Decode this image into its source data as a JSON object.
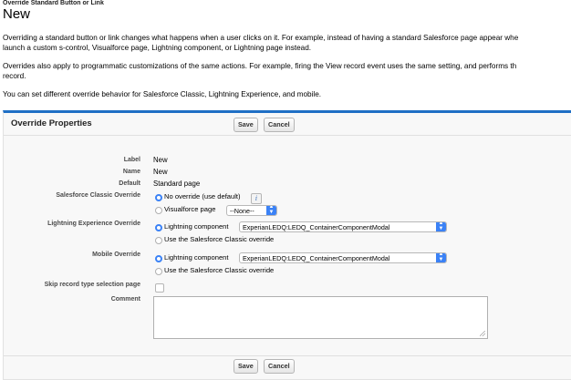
{
  "page": {
    "breadcrumb": "Override Standard Button or Link",
    "title": "New",
    "paragraph1_line1": "Overriding a standard button or link changes what happens when a user clicks on it. For example, instead of having a standard Salesforce page appear whe",
    "paragraph1_line2": "launch a custom s-control, Visualforce page, Lightning component, or Lightning page instead.",
    "paragraph2_line1": "Overrides also apply to programmatic customizations of the same actions. For example, firing the View record event uses the same setting, and performs th",
    "paragraph2_line2": "record.",
    "paragraph3": "You can set different override behavior for Salesforce Classic, Lightning Experience, and mobile."
  },
  "panel": {
    "title": "Override Properties",
    "save_label": "Save",
    "cancel_label": "Cancel"
  },
  "fields": {
    "label_label": "Label",
    "label_value": "New",
    "name_label": "Name",
    "name_value": "New",
    "default_label": "Default",
    "default_value": "Standard page",
    "classic_label": "Salesforce Classic Override",
    "classic_option1": "No override (use default)",
    "classic_option2": "Visualforce page",
    "classic_vf_select": "--None--",
    "lightning_label": "Lightning Experience Override",
    "lightning_option1": "Lightning component",
    "lightning_component_select": "ExperianLEDQ:LEDQ_ContainerComponentModal",
    "lightning_option2": "Use the Salesforce Classic override",
    "mobile_label": "Mobile Override",
    "mobile_option1": "Lightning component",
    "mobile_component_select": "ExperianLEDQ:LEDQ_ContainerComponentModal",
    "mobile_option2": "Use the Salesforce Classic override",
    "skip_label": "Skip record type selection page",
    "comment_label": "Comment",
    "comment_value": ""
  },
  "colors": {
    "accent": "#1f6fc5",
    "radio_selected": "#3b82f6"
  }
}
